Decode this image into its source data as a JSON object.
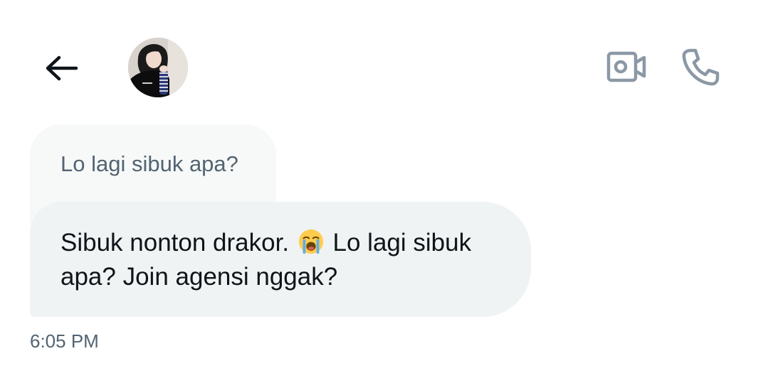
{
  "header": {
    "back_icon": "arrow-left-icon",
    "avatar_icon": "user-avatar",
    "video_icon": "video-camera-icon",
    "call_icon": "phone-icon"
  },
  "messages": {
    "quoted": {
      "text": "Lo lagi sibuk apa?"
    },
    "reply": {
      "part1": "Sibuk nonton drakor.",
      "emoji": "loudly-crying-face",
      "part2": "Lo lagi sibuk apa? Join agensi nggak?"
    },
    "timestamp": "6:05 PM"
  },
  "colors": {
    "icon_dark": "#0f1419",
    "icon_gray": "#8b98a5",
    "quoted_bg": "#f7f9f9",
    "bubble_bg": "#eff3f4",
    "secondary_text": "#536471"
  }
}
